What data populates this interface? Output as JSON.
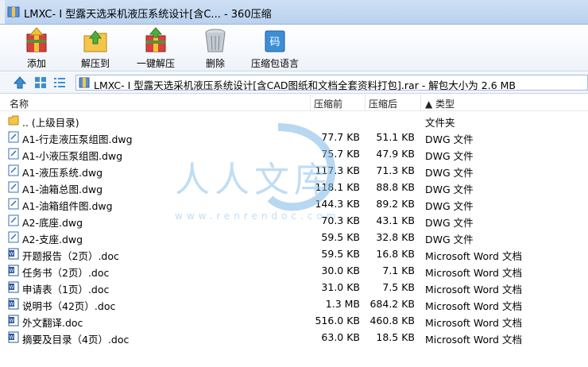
{
  "window": {
    "title": "LMXC- I 型露天选采机液压系统设计[含C... - 360压缩"
  },
  "toolbar": {
    "add": "添加",
    "extract_to": "解压到",
    "one_click_extract": "一键解压",
    "delete": "删除",
    "language": "压缩包语言"
  },
  "address": {
    "path": "LMXC- I 型露天选采机液压系统设计[含CAD图纸和文档全套资料打包].rar - 解包大小为 2.6 MB"
  },
  "columns": {
    "name": "名称",
    "size": "压缩前",
    "packed": "压缩后",
    "type": "▲ 类型"
  },
  "rows": [
    {
      "name": ".. (上级目录)",
      "size": "",
      "packed": "",
      "type": "文件夹",
      "icon": "folder-icon"
    },
    {
      "name": "A1-行走液压泵组图.dwg",
      "size": "77.7 KB",
      "packed": "51.1 KB",
      "type": "DWG 文件",
      "icon": "dwg-file-icon"
    },
    {
      "name": "A1-小液压泵组图.dwg",
      "size": "75.7 KB",
      "packed": "47.9 KB",
      "type": "DWG 文件",
      "icon": "dwg-file-icon"
    },
    {
      "name": "A1-液压系统.dwg",
      "size": "117.3 KB",
      "packed": "71.3 KB",
      "type": "DWG 文件",
      "icon": "dwg-file-icon"
    },
    {
      "name": "A1-油箱总图.dwg",
      "size": "118.1 KB",
      "packed": "88.8 KB",
      "type": "DWG 文件",
      "icon": "dwg-file-icon"
    },
    {
      "name": "A1-油箱组件图.dwg",
      "size": "144.3 KB",
      "packed": "89.2 KB",
      "type": "DWG 文件",
      "icon": "dwg-file-icon"
    },
    {
      "name": "A2-底座.dwg",
      "size": "70.3 KB",
      "packed": "43.1 KB",
      "type": "DWG 文件",
      "icon": "dwg-file-icon"
    },
    {
      "name": "A2-支座.dwg",
      "size": "59.5 KB",
      "packed": "32.8 KB",
      "type": "DWG 文件",
      "icon": "dwg-file-icon"
    },
    {
      "name": "开题报告（2页）.doc",
      "size": "59.5 KB",
      "packed": "16.8 KB",
      "type": "Microsoft Word 文档",
      "icon": "word-doc-icon"
    },
    {
      "name": "任务书（2页）.doc",
      "size": "30.0 KB",
      "packed": "7.1 KB",
      "type": "Microsoft Word 文档",
      "icon": "word-doc-icon"
    },
    {
      "name": "申请表（1页）.doc",
      "size": "31.0 KB",
      "packed": "7.5 KB",
      "type": "Microsoft Word 文档",
      "icon": "word-doc-icon"
    },
    {
      "name": "说明书（42页）.doc",
      "size": "1.3 MB",
      "packed": "684.2 KB",
      "type": "Microsoft Word 文档",
      "icon": "word-doc-icon"
    },
    {
      "name": "外文翻译.doc",
      "size": "516.0 KB",
      "packed": "460.8 KB",
      "type": "Microsoft Word 文档",
      "icon": "word-doc-icon"
    },
    {
      "name": "摘要及目录（4页）.doc",
      "size": "63.0 KB",
      "packed": "18.5 KB",
      "type": "Microsoft Word 文档",
      "icon": "word-doc-icon"
    }
  ],
  "watermark": {
    "logo_text": "人人文库",
    "url": "www.renrendoc.com"
  }
}
